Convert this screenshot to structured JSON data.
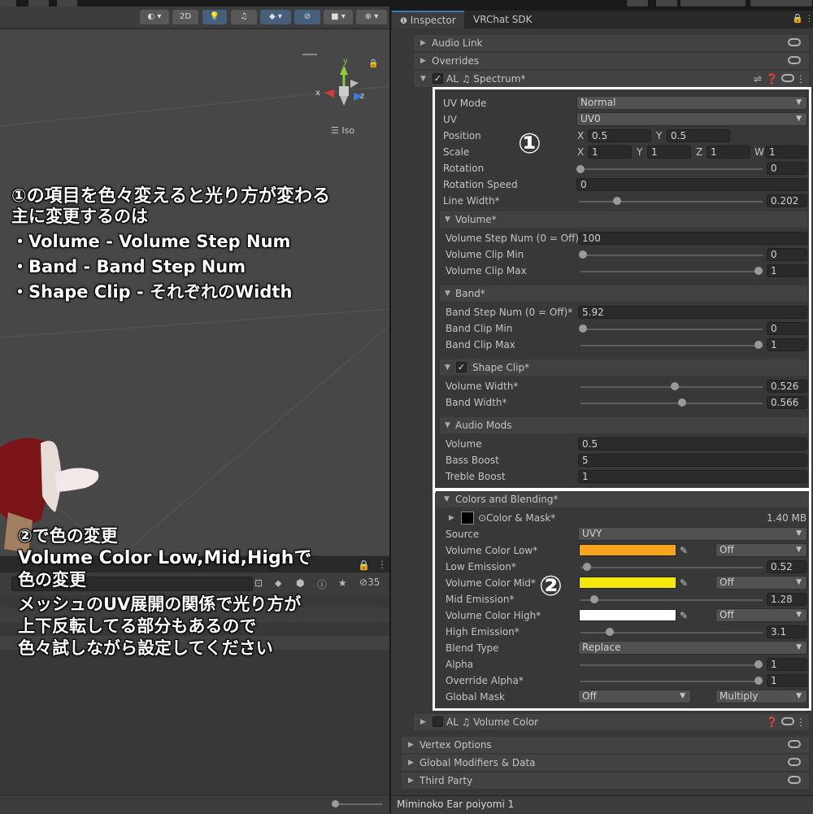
{
  "scene": {
    "toolbar": {
      "btn_2d": "2D",
      "axis_y": "y",
      "axis_x": "x",
      "axis_z": "z",
      "iso_label": "Iso"
    },
    "annotation_1": {
      "line1": "①の項目を色々変えると光り方が変わる",
      "line2": "主に変更するのは",
      "line3": "・Volume - Volume Step Num",
      "line4": "・Band - Band Step Num",
      "line5": "・Shape Clip - それぞれのWidth"
    },
    "annotation_2": {
      "line1": "②で色の変更",
      "line2": "Volume Color Low,Mid,Highで",
      "line3": "色の変更",
      "line4": "メッシュのUV展開の関係で光り方が",
      "line5": "上下反転してる部分もあるので",
      "line6": "色々試しながら設定してください"
    }
  },
  "bottom_left": {
    "hidden_count": "35"
  },
  "inspector": {
    "tabs": {
      "inspector": "Inspector",
      "vrchat_sdk": "VRChat SDK"
    },
    "sections_top": {
      "audio_link": "Audio Link",
      "overrides": "Overrides",
      "spectrum": "AL ♫ Spectrum*"
    },
    "marker_1": "①",
    "marker_2": "②",
    "spectrum": {
      "uv_mode": {
        "label": "UV Mode",
        "value": "Normal"
      },
      "uv": {
        "label": "UV",
        "value": "UV0"
      },
      "position": {
        "label": "Position",
        "x_label": "X",
        "x": "0.5",
        "y_label": "Y",
        "y": "0.5"
      },
      "scale": {
        "label": "Scale",
        "x_label": "X",
        "x": "1",
        "y_label": "Y",
        "y": "1",
        "z_label": "Z",
        "z": "1",
        "w_label": "W",
        "w": "1"
      },
      "rotation": {
        "label": "Rotation",
        "value": "0"
      },
      "rotation_speed": {
        "label": "Rotation Speed",
        "value": "0"
      },
      "line_width": {
        "label": "Line Width*",
        "value": "0.202"
      }
    },
    "volume": {
      "header": "Volume*",
      "step_num": {
        "label": "Volume Step Num (0 = Off)*",
        "value": "100"
      },
      "clip_min": {
        "label": "Volume Clip Min",
        "value": "0"
      },
      "clip_max": {
        "label": "Volume Clip Max",
        "value": "1"
      }
    },
    "band": {
      "header": "Band*",
      "step_num": {
        "label": "Band Step Num (0 = Off)*",
        "value": "5.92"
      },
      "clip_min": {
        "label": "Band Clip Min",
        "value": "0"
      },
      "clip_max": {
        "label": "Band Clip Max",
        "value": "1"
      }
    },
    "shape_clip": {
      "header": "Shape Clip*",
      "volume_width": {
        "label": "Volume Width*",
        "value": "0.526"
      },
      "band_width": {
        "label": "Band Width*",
        "value": "0.566"
      }
    },
    "audio_mods": {
      "header": "Audio Mods",
      "volume": {
        "label": "Volume",
        "value": "0.5"
      },
      "bass_boost": {
        "label": "Bass Boost",
        "value": "5"
      },
      "treble_boost": {
        "label": "Treble Boost",
        "value": "1"
      }
    },
    "colors": {
      "header": "Colors and Blending*",
      "color_mask": {
        "label": "⊙Color & Mask*",
        "size": "1.40 MB"
      },
      "source": {
        "label": "Source",
        "value": "UVY"
      },
      "color_low": {
        "label": "Volume Color Low*",
        "color": "#f6a51c",
        "mode": "Off"
      },
      "low_emission": {
        "label": "Low Emission*",
        "value": "0.52"
      },
      "color_mid": {
        "label": "Volume Color Mid*",
        "color": "#f5e70a",
        "mode": "Off"
      },
      "mid_emission": {
        "label": "Mid Emission*",
        "value": "1.28"
      },
      "color_high": {
        "label": "Volume Color High*",
        "color": "#ffffff",
        "mode": "Off"
      },
      "high_emission": {
        "label": "High Emission*",
        "value": "3.1"
      },
      "blend_type": {
        "label": "Blend Type",
        "value": "Replace"
      },
      "alpha": {
        "label": "Alpha",
        "value": "1"
      },
      "override_alpha": {
        "label": "Override Alpha*",
        "value": "1"
      },
      "global_mask": {
        "label": "Global Mask",
        "value": "Off",
        "mode": "Multiply"
      }
    },
    "sections_bottom": {
      "volume_color": "AL ♫ Volume Color",
      "vertex_options": "Vertex Options",
      "global_modifiers": "Global Modifiers & Data",
      "third_party": "Third Party"
    },
    "status": "Miminoko Ear poiyomi 1"
  }
}
